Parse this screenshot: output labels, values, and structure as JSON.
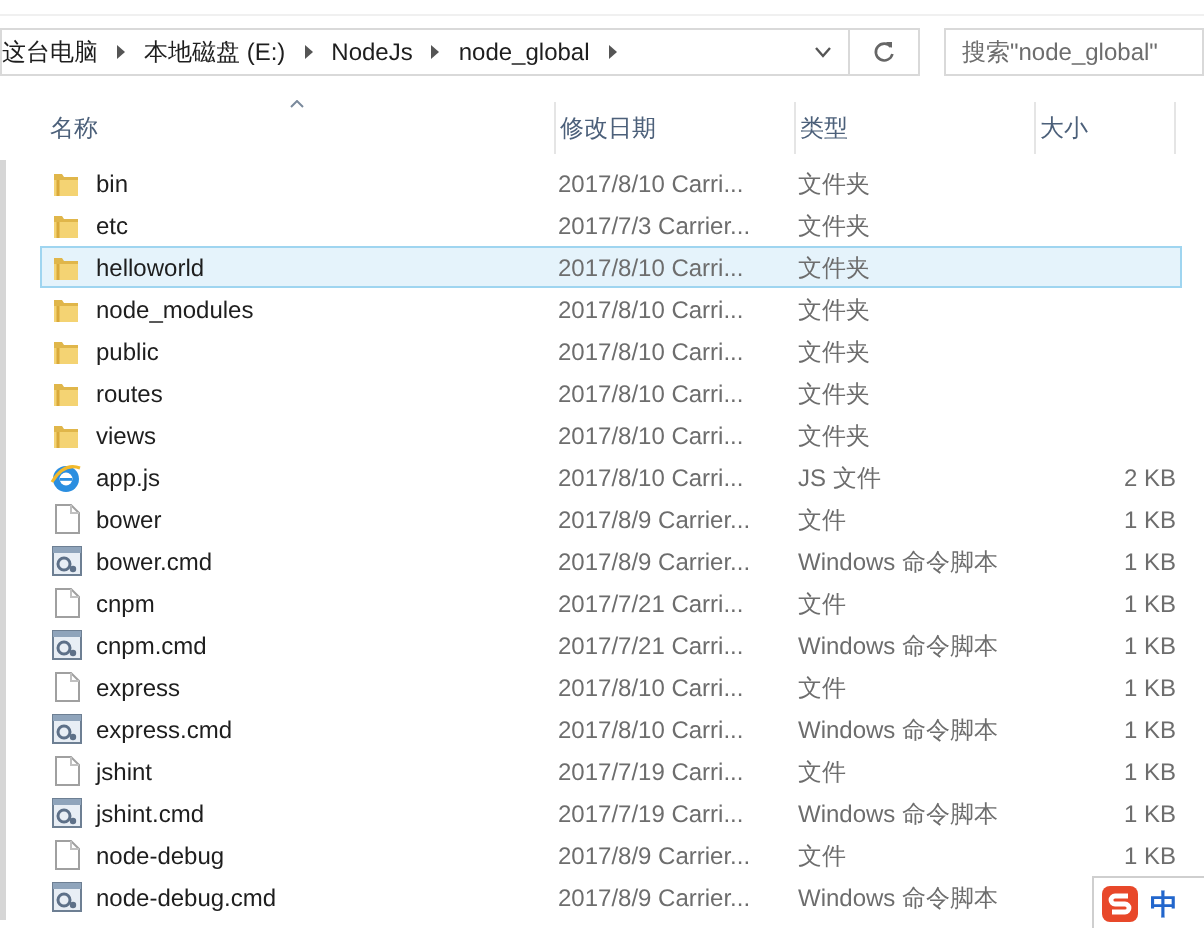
{
  "address_bar": {
    "breadcrumbs": [
      "这台电脑",
      "本地磁盘 (E:)",
      "NodeJs",
      "node_global"
    ]
  },
  "search": {
    "placeholder": "搜索\"node_global\""
  },
  "columns": [
    "名称",
    "修改日期",
    "类型",
    "大小"
  ],
  "rows": [
    {
      "name": "bin",
      "date": "2017/8/10 Carri...",
      "type": "文件夹",
      "kind": "folder",
      "selected": false
    },
    {
      "name": "etc",
      "date": "2017/7/3 Carrier...",
      "type": "文件夹",
      "kind": "folder",
      "selected": false
    },
    {
      "name": "helloworld",
      "date": "2017/8/10 Carri...",
      "type": "文件夹",
      "kind": "folder",
      "selected": true
    },
    {
      "name": "node_modules",
      "date": "2017/8/10 Carri...",
      "type": "文件夹",
      "kind": "folder",
      "selected": false
    },
    {
      "name": "public",
      "date": "2017/8/10 Carri...",
      "type": "文件夹",
      "kind": "folder",
      "selected": false
    },
    {
      "name": "routes",
      "date": "2017/8/10 Carri...",
      "type": "文件夹",
      "kind": "folder",
      "selected": false
    },
    {
      "name": "views",
      "date": "2017/8/10 Carri...",
      "type": "文件夹",
      "kind": "folder",
      "selected": false
    },
    {
      "name": "app.js",
      "date": "2017/8/10 Carri...",
      "type": "JS 文件",
      "size": "2 KB",
      "kind": "script",
      "selected": false
    },
    {
      "name": "bower",
      "date": "2017/8/9 Carrier...",
      "type": "文件",
      "size": "1 KB",
      "kind": "file",
      "selected": false
    },
    {
      "name": "bower.cmd",
      "date": "2017/8/9 Carrier...",
      "type": "Windows 命令脚本",
      "size": "1 KB",
      "kind": "cmd",
      "selected": false
    },
    {
      "name": "cnpm",
      "date": "2017/7/21 Carri...",
      "type": "文件",
      "size": "1 KB",
      "kind": "file",
      "selected": false
    },
    {
      "name": "cnpm.cmd",
      "date": "2017/7/21 Carri...",
      "type": "Windows 命令脚本",
      "size": "1 KB",
      "kind": "cmd",
      "selected": false
    },
    {
      "name": "express",
      "date": "2017/8/10 Carri...",
      "type": "文件",
      "size": "1 KB",
      "kind": "file",
      "selected": false
    },
    {
      "name": "express.cmd",
      "date": "2017/8/10 Carri...",
      "type": "Windows 命令脚本",
      "size": "1 KB",
      "kind": "cmd",
      "selected": false
    },
    {
      "name": "jshint",
      "date": "2017/7/19 Carri...",
      "type": "文件",
      "size": "1 KB",
      "kind": "file",
      "selected": false
    },
    {
      "name": "jshint.cmd",
      "date": "2017/7/19 Carri...",
      "type": "Windows 命令脚本",
      "size": "1 KB",
      "kind": "cmd",
      "selected": false
    },
    {
      "name": "node-debug",
      "date": "2017/8/9 Carrier...",
      "type": "文件",
      "size": "1 KB",
      "kind": "file",
      "selected": false
    },
    {
      "name": "node-debug.cmd",
      "date": "2017/8/9 Carrier...",
      "type": "Windows 命令脚本",
      "kind": "cmd",
      "selected": false
    }
  ],
  "ime": {
    "label": "中"
  }
}
